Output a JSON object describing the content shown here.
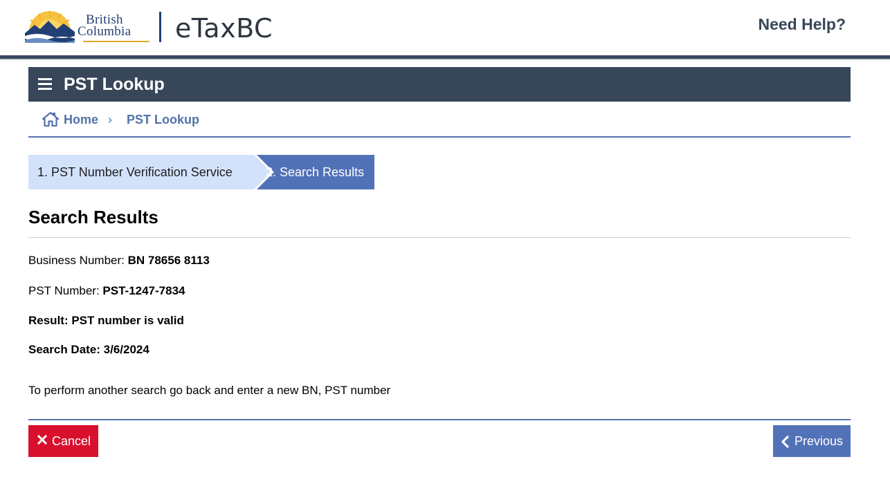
{
  "header": {
    "logo_line1": "British",
    "logo_line2": "Columbia",
    "app_name": "eTaxBC",
    "help_link": "Need Help?"
  },
  "title_bar": {
    "title": "PST Lookup"
  },
  "breadcrumb": {
    "home": "Home",
    "separator": "›",
    "current": "PST Lookup"
  },
  "steps": [
    {
      "label": "1. PST Number Verification Service",
      "state": "completed"
    },
    {
      "label": "2. Search Results",
      "state": "active"
    }
  ],
  "results": {
    "heading": "Search Results",
    "business_number_label": "Business Number:",
    "business_number_value": "BN 78656 8113",
    "pst_number_label": "PST Number:",
    "pst_number_value": "PST-1247-7834",
    "result": "Result: PST number is valid",
    "search_date": "Search Date: 3/6/2024",
    "hint": "To perform another search go back and enter a new BN, PST number"
  },
  "actions": {
    "cancel_label": "Cancel",
    "previous_label": "Previous"
  },
  "colors": {
    "header_dark": "#38465a",
    "link_blue": "#5272a8",
    "step_active": "#5272b8",
    "step_done": "#d3e2fb",
    "cancel_red": "#d8102e",
    "logo_gold": "#e3a82b",
    "logo_navy": "#234075"
  },
  "icons": {
    "menu": "hamburger-menu-icon",
    "home": "home-icon",
    "cancel": "close-x-icon",
    "previous": "chevron-left-icon"
  }
}
